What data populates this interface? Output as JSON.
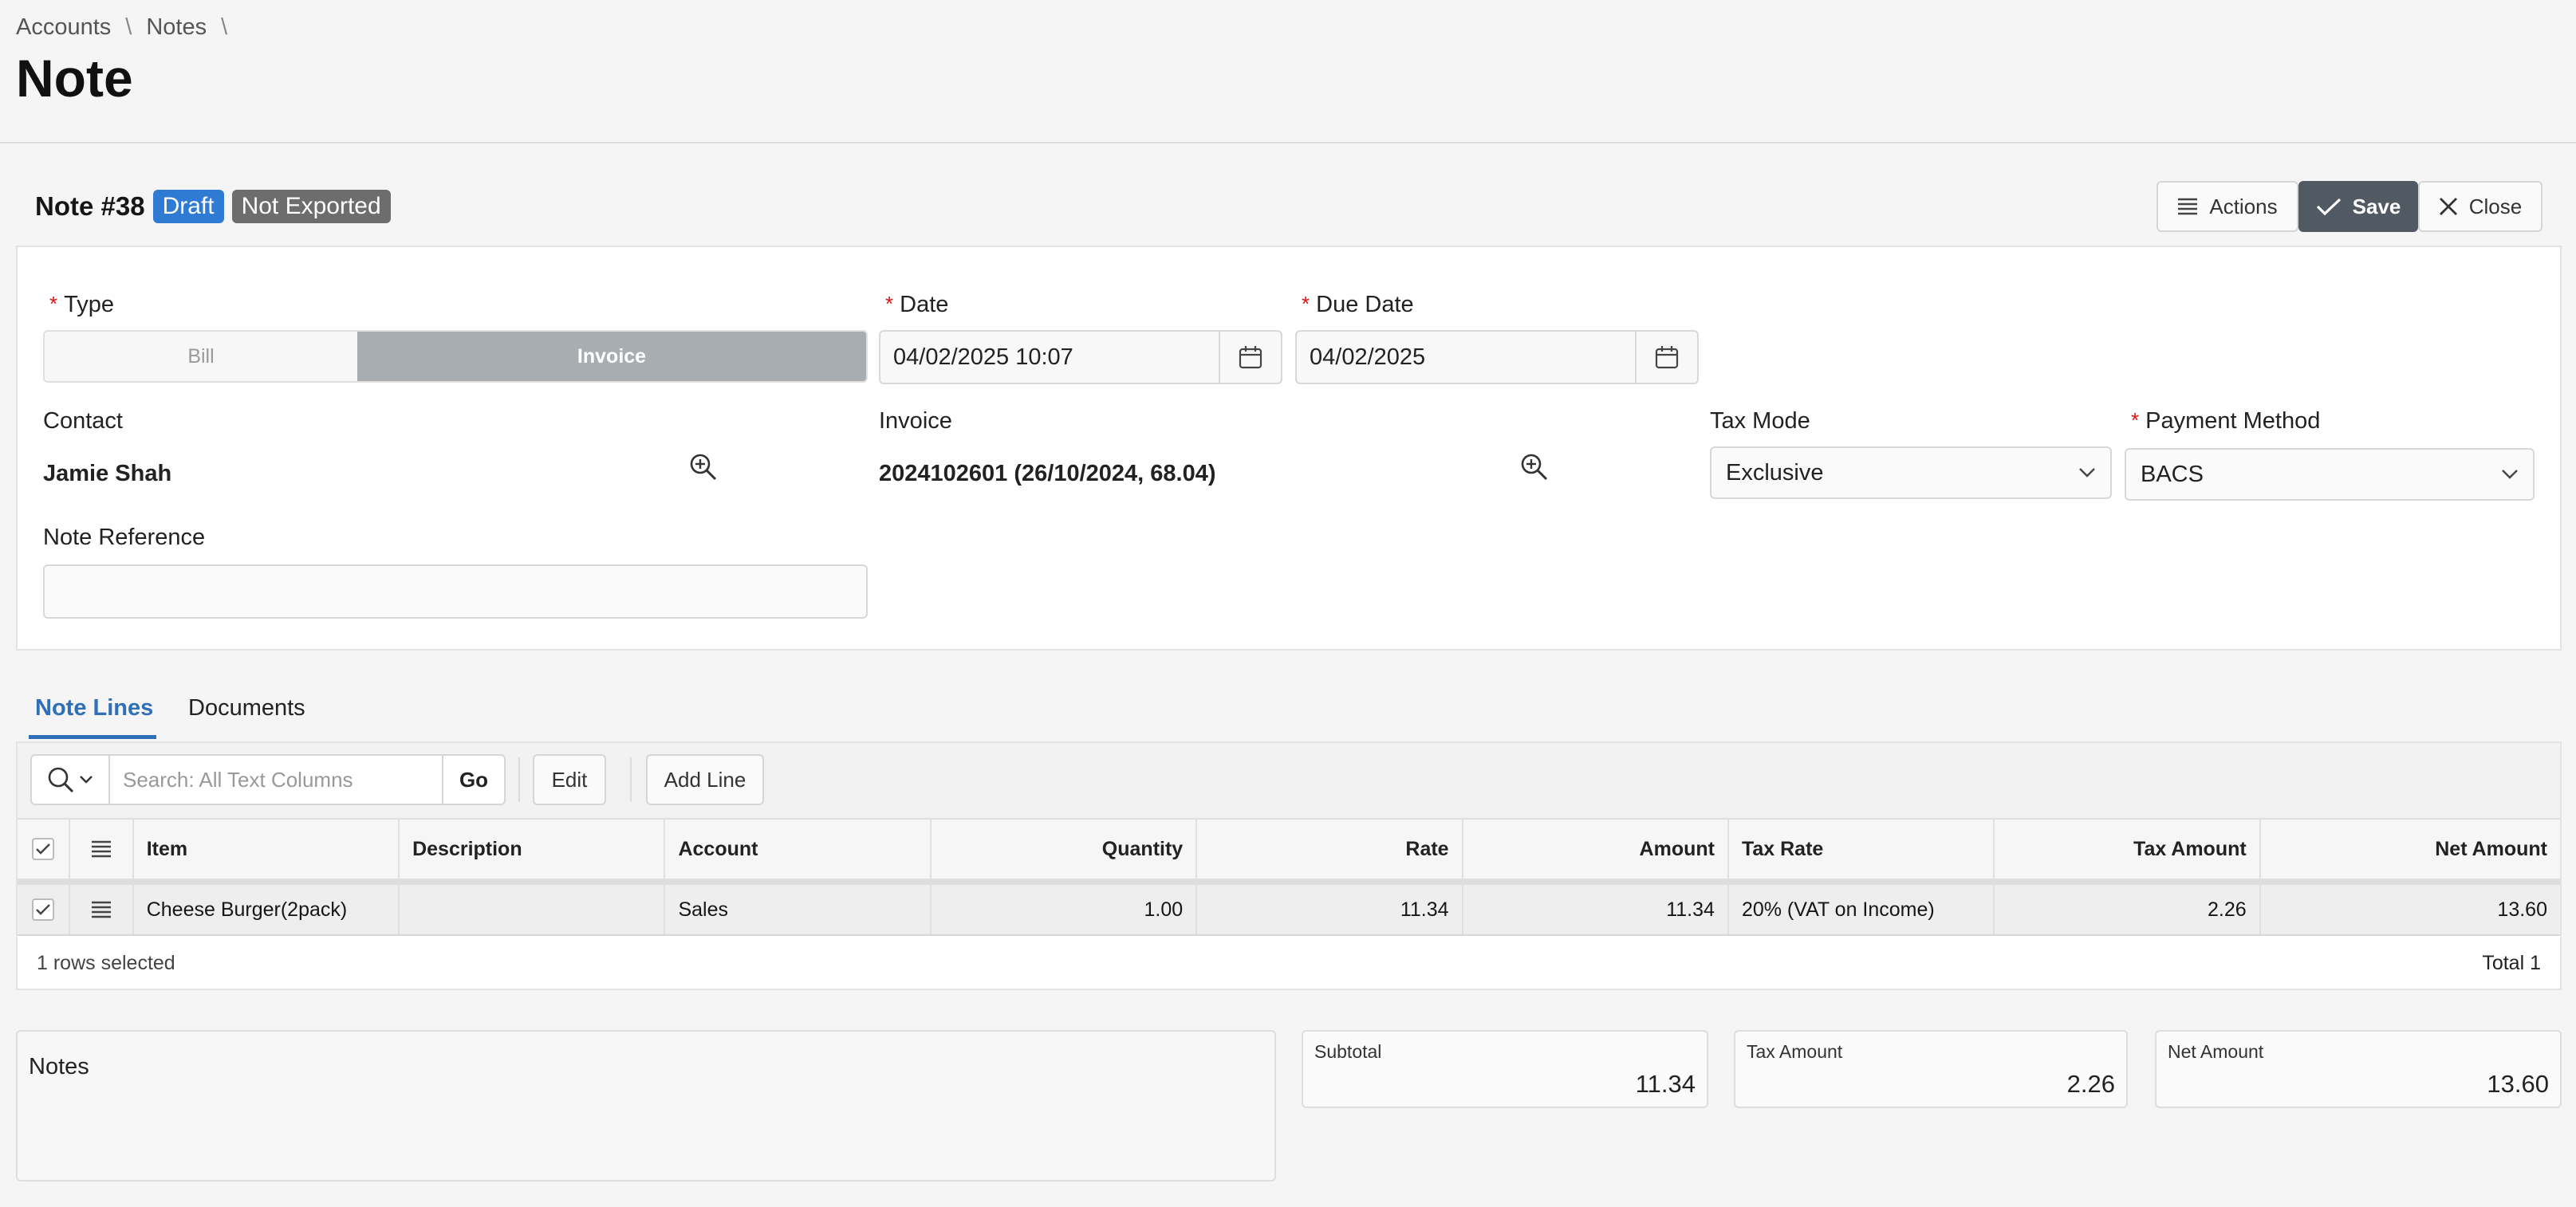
{
  "breadcrumb": {
    "items": [
      "Accounts",
      "Notes"
    ],
    "separator": "\\"
  },
  "page": {
    "title": "Note"
  },
  "region": {
    "heading": "Note #38",
    "badges": {
      "draft": "Draft",
      "not_exported": "Not Exported"
    },
    "buttons": {
      "actions": "Actions",
      "save": "Save",
      "close": "Close"
    }
  },
  "form": {
    "type": {
      "label": "Type",
      "options": [
        "Bill",
        "Invoice"
      ],
      "selected": "Invoice"
    },
    "date": {
      "label": "Date",
      "value": "04/02/2025 10:07"
    },
    "due_date": {
      "label": "Due Date",
      "value": "04/02/2025"
    },
    "contact": {
      "label": "Contact",
      "value": "Jamie Shah"
    },
    "invoice": {
      "label": "Invoice",
      "value": "2024102601 (26/10/2024, 68.04)"
    },
    "tax_mode": {
      "label": "Tax Mode",
      "value": "Exclusive"
    },
    "payment_method": {
      "label": "Payment Method",
      "value": "BACS"
    },
    "note_reference": {
      "label": "Note Reference",
      "value": ""
    },
    "required_mark": "*"
  },
  "tabs": {
    "note_lines": "Note Lines",
    "documents": "Documents"
  },
  "grid": {
    "search_placeholder": "Search: All Text Columns",
    "go_label": "Go",
    "edit_label": "Edit",
    "add_line_label": "Add Line",
    "columns": [
      "Item",
      "Description",
      "Account",
      "Quantity",
      "Rate",
      "Amount",
      "Tax Rate",
      "Tax Amount",
      "Net Amount"
    ],
    "rows": [
      {
        "item": "Cheese Burger(2pack)",
        "description": "",
        "account": "Sales",
        "quantity": "1.00",
        "rate": "11.34",
        "amount": "11.34",
        "tax_rate": "20% (VAT on Income)",
        "tax_amount": "2.26",
        "net_amount": "13.60"
      }
    ],
    "footer": {
      "selected": "1 rows selected",
      "total": "Total 1"
    }
  },
  "bottom": {
    "notes_label": "Notes",
    "subtotal": {
      "label": "Subtotal",
      "value": "11.34"
    },
    "tax_amount": {
      "label": "Tax Amount",
      "value": "2.26"
    },
    "net_amount": {
      "label": "Net Amount",
      "value": "13.60"
    }
  },
  "colors": {
    "accent": "#2f6fb7",
    "draft_badge": "#2f7bd4",
    "not_exported_badge": "#6d6d6d",
    "save_button": "#515a63",
    "required": "#dd1111"
  }
}
